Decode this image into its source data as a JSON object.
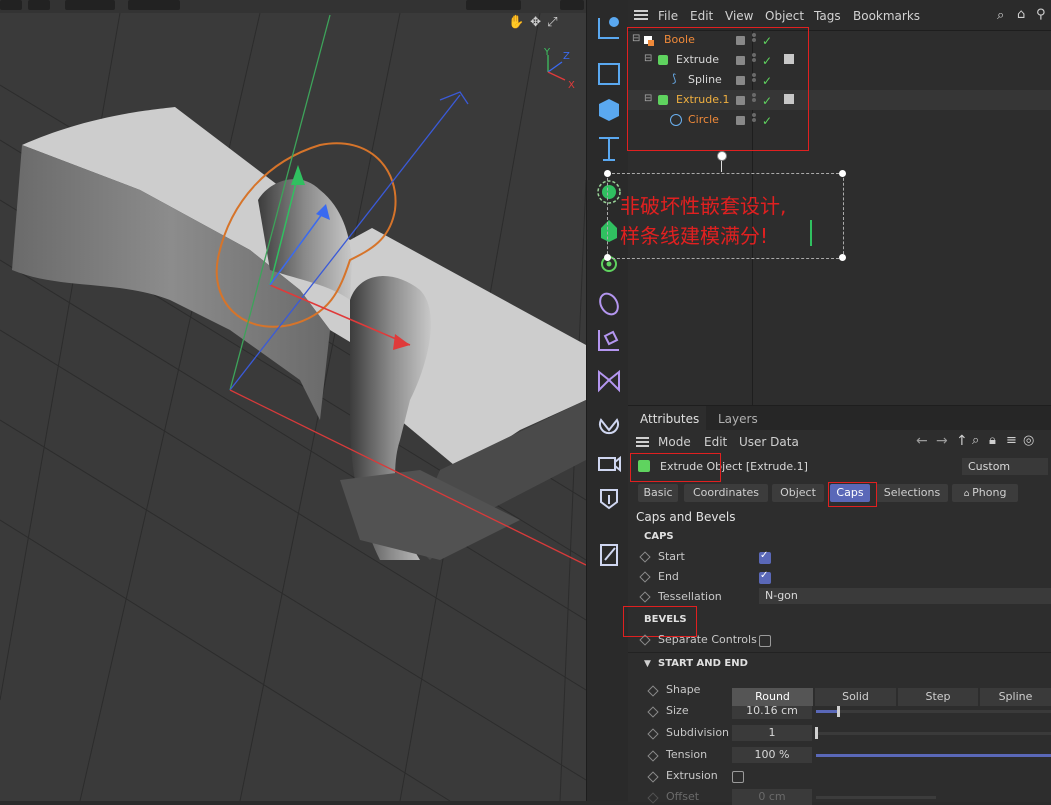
{
  "object_manager": {
    "menu": [
      "File",
      "Edit",
      "View",
      "Object",
      "Tags",
      "Bookmarks"
    ],
    "tree": [
      {
        "name": "Boole",
        "color": "#f08a3a"
      },
      {
        "name": "Extrude",
        "color": "#d8d8d8"
      },
      {
        "name": "Spline",
        "color": "#d8d8d8"
      },
      {
        "name": "Extrude.1",
        "color": "#f0b040"
      },
      {
        "name": "Circle",
        "color": "#f08a3a"
      }
    ]
  },
  "annotation": {
    "line1": "非破坏性嵌套设计,",
    "line2": "样条线建模满分!",
    "color": "#e02020"
  },
  "attributes": {
    "tabs": [
      "Attributes",
      "Layers"
    ],
    "menu": [
      "Mode",
      "Edit",
      "User Data"
    ],
    "object_title": "Extrude Object [Extrude.1]",
    "preset": "Custom",
    "subtabs": [
      "Basic",
      "Coordinates",
      "Object",
      "Caps",
      "Selections",
      "Phong"
    ],
    "active_subtab": "Caps",
    "section_title": "Caps and Bevels",
    "caps_header": "CAPS",
    "start_label": "Start",
    "start_checked": true,
    "end_label": "End",
    "end_checked": true,
    "tessellation_label": "Tessellation",
    "tessellation_value": "N-gon",
    "bevels_header": "BEVELS",
    "separate_controls_label": "Separate Controls",
    "separate_controls_checked": false,
    "start_end_header": "START AND END",
    "shape_label": "Shape",
    "shape_options": [
      "Round",
      "Solid",
      "Step",
      "Spline"
    ],
    "shape_selected": "Round",
    "size_label": "Size",
    "size_value": "10.16 cm",
    "subdivision_label": "Subdivision",
    "subdivision_value": "1",
    "tension_label": "Tension",
    "tension_value": "100 %",
    "extrusion_label": "Extrusion",
    "extrusion_checked": false,
    "offset_label": "Offset",
    "offset_value": "0 cm"
  },
  "viewport": {
    "axis_x": "X",
    "axis_y": "Y",
    "axis_z": "Z"
  },
  "colors": {
    "accent": "#5a68b8",
    "check": "#5fd35f",
    "highlight_box": "#e02020"
  }
}
